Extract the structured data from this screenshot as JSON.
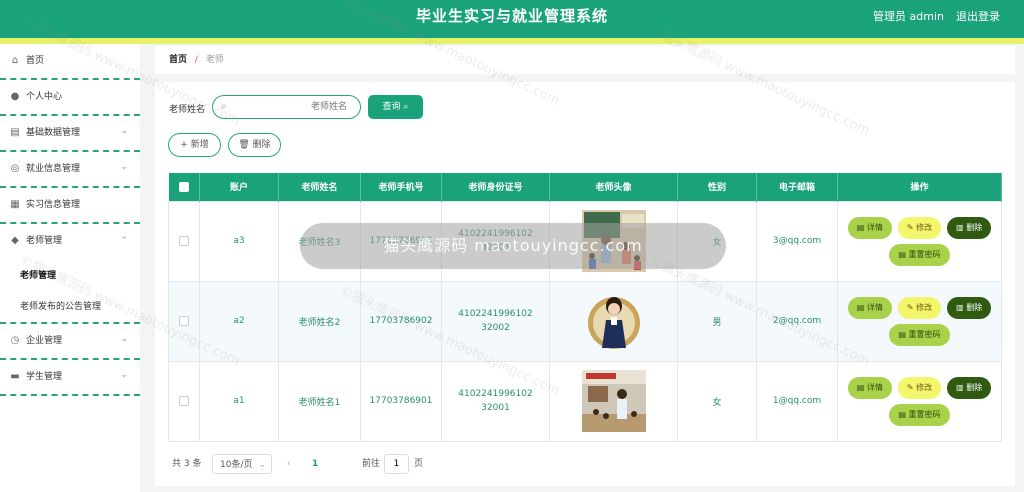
{
  "header": {
    "title": "毕业生实习与就业管理系统",
    "admin_label": "管理员 admin",
    "logout_label": "退出登录",
    "primary_color": "#1aa27a",
    "stripe_color": "#e7f26a"
  },
  "sidebar": {
    "items": [
      {
        "label": "首页",
        "icon": "home-icon"
      },
      {
        "label": "个人中心",
        "icon": "user-icon"
      },
      {
        "label": "基础数据管理",
        "icon": "chart-icon"
      },
      {
        "label": "就业信息管理",
        "icon": "globe-icon"
      },
      {
        "label": "实习信息管理",
        "icon": "document-icon"
      },
      {
        "label": "老师管理",
        "icon": "location-icon"
      },
      {
        "label": "企业管理",
        "icon": "clock-icon"
      },
      {
        "label": "学生管理",
        "icon": "monitor-icon"
      }
    ],
    "submenu": [
      {
        "label": "老师管理"
      },
      {
        "label": "老师发布的公告管理"
      }
    ]
  },
  "breadcrumb": {
    "home": "首页",
    "separator": "/",
    "current": "老师"
  },
  "search": {
    "label": "老师姓名",
    "placeholder": "老师姓名",
    "button_label": "查询"
  },
  "toolbar": {
    "add_label": "新增",
    "delete_label": "删除"
  },
  "table": {
    "headers": [
      "账户",
      "老师姓名",
      "老师手机号",
      "老师身份证号",
      "老师头像",
      "性别",
      "电子邮箱",
      "操作"
    ],
    "rows": [
      {
        "account": "a3",
        "name": "老师姓名3",
        "phone": "17703786903",
        "id_line1": "4102241996102",
        "id_line2": "32003",
        "gender": "女",
        "email": "3@qq.com"
      },
      {
        "account": "a2",
        "name": "老师姓名2",
        "phone": "17703786902",
        "id_line1": "4102241996102",
        "id_line2": "32002",
        "gender": "男",
        "email": "2@qq.com"
      },
      {
        "account": "a1",
        "name": "老师姓名1",
        "phone": "17703786901",
        "id_line1": "4102241996102",
        "id_line2": "32001",
        "gender": "女",
        "email": "1@qq.com"
      }
    ],
    "actions": {
      "detail": "详情",
      "edit": "修改",
      "delete": "删除",
      "reset_password": "重置密码"
    }
  },
  "pagination": {
    "total": "共 3 条",
    "page_size": "10条/页",
    "current_page": "1",
    "goto_label": "前往",
    "goto_value": "1",
    "page_unit": "页"
  },
  "watermark": {
    "overlay_text": "猫头鹰源码 maotouyingcc.com",
    "tile_text": "©猫头鹰源码 www.maotouyingcc.com"
  }
}
